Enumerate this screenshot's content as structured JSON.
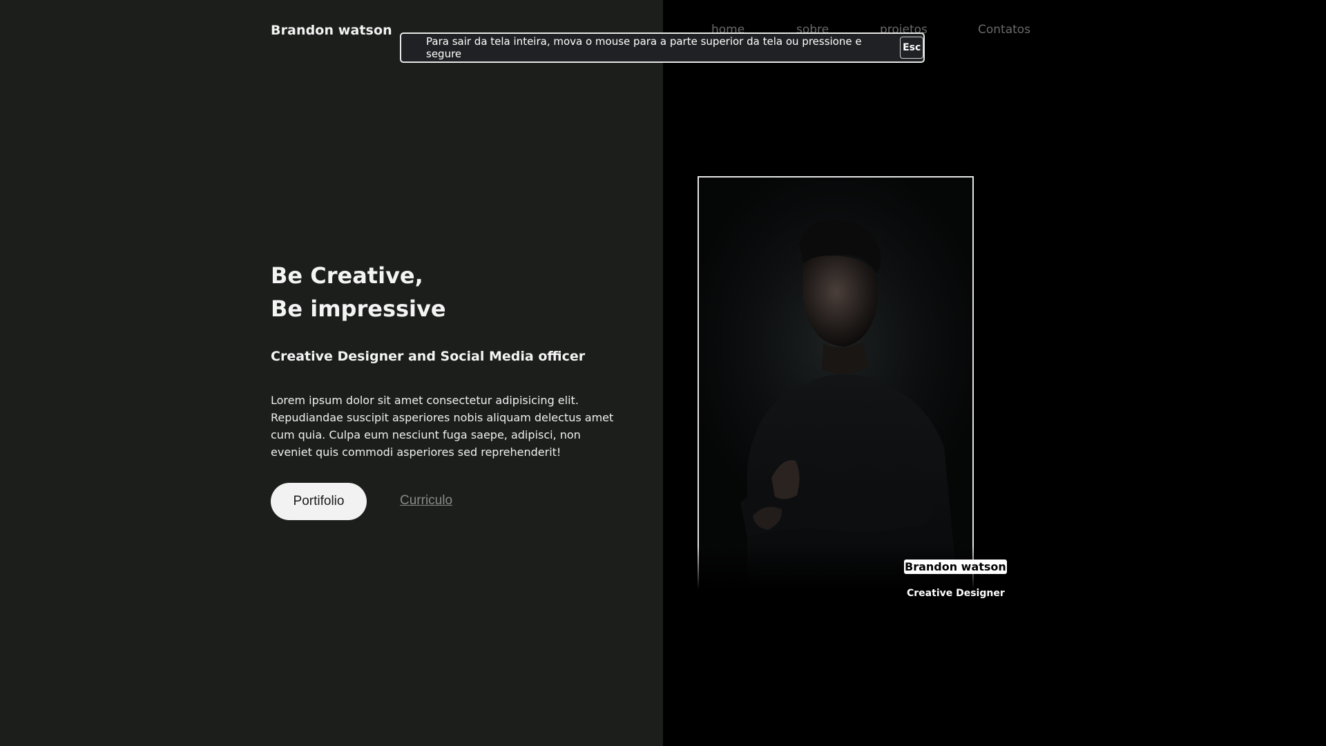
{
  "header": {
    "brand": "Brandon watson",
    "nav": [
      "home",
      "sobre",
      "projetos",
      "Contatos"
    ]
  },
  "fullscreen_notice": {
    "text": "Para sair da tela inteira, mova o mouse para a parte superior da tela ou pressione e segure",
    "key": "Esc"
  },
  "hero": {
    "headline_line1": "Be Creative,",
    "headline_line2": "Be impressive",
    "subtitle": "Creative Designer and Social Media officer",
    "body": "Lorem ipsum dolor sit amet consectetur adipisicing elit. Repudiandae suscipit asperiores nobis aliquam delectus amet cum quia. Culpa eum nesciunt fuga saepe, adipisci, non eveniet quis commodi asperiores sed reprehenderit!",
    "primary_button": "Portifolio",
    "secondary_link": "Curriculo"
  },
  "profile_card": {
    "name": "Brandon watson",
    "role": "Creative Designer"
  },
  "colors": {
    "left_background": "#1c1e1c",
    "right_background": "#000000",
    "text_primary": "#f4f4f4",
    "nav_text": "#6a6a6a",
    "button_background": "#f2f2f2",
    "banner_background": "#202124"
  }
}
